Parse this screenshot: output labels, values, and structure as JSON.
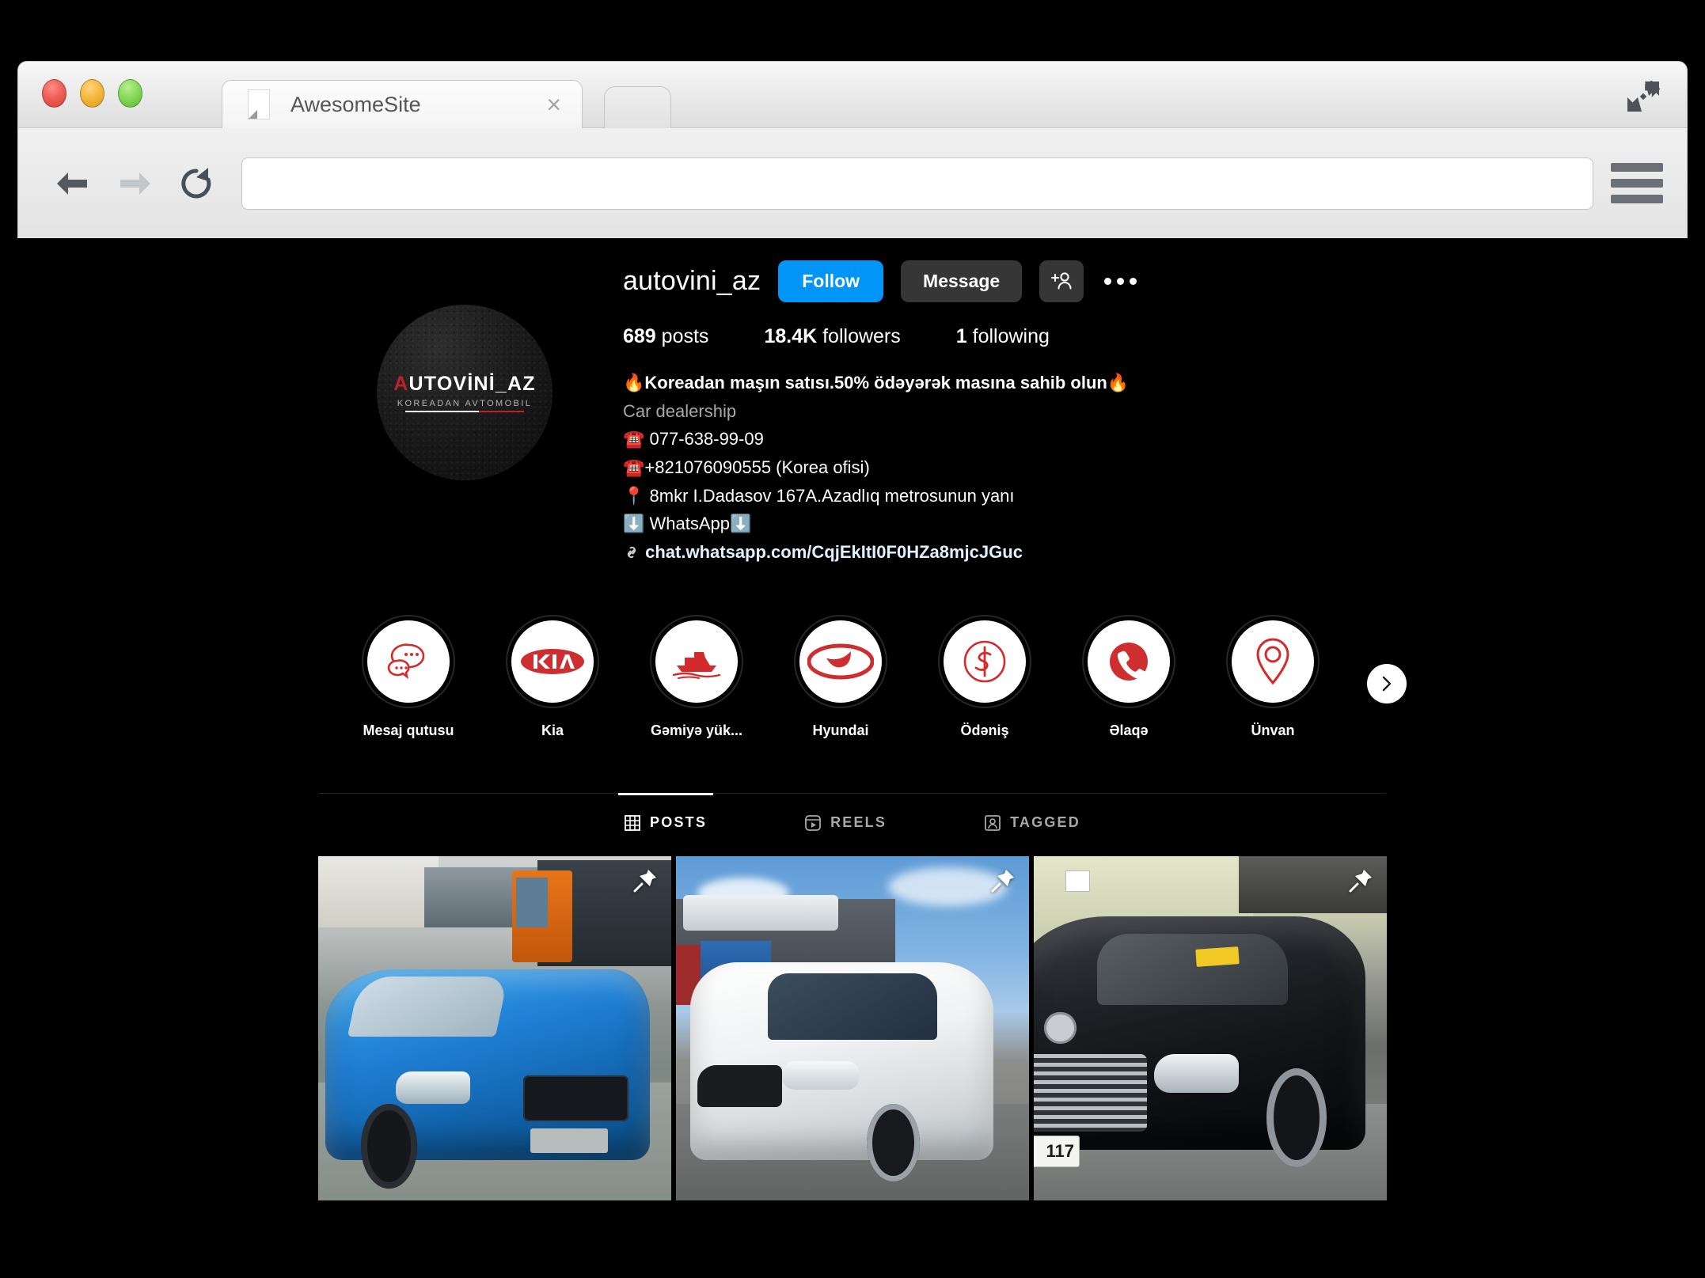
{
  "browser": {
    "tab_title": "AwesomeSite",
    "url_value": "",
    "url_placeholder": "",
    "back_label": "Back",
    "forward_label": "Forward",
    "reload_label": "Reload",
    "menu_label": "Menu",
    "expand_label": "Full screen",
    "close_tab_label": "×"
  },
  "profile": {
    "username": "autovini_az",
    "avatar": {
      "logo_a": "A",
      "logo_rest": "UTOVİNİ_AZ",
      "subtitle": "KOREADAN AVTOMOBIL"
    },
    "buttons": {
      "follow": "Follow",
      "message": "Message",
      "add_user": "add-user",
      "more": "more-options"
    },
    "stats": {
      "posts_count": "689",
      "posts_label": "posts",
      "followers_count": "18.4K",
      "followers_label": "followers",
      "following_count": "1",
      "following_label": "following"
    },
    "bio": {
      "title": "🔥Koreadan maşın satısı.50% ödəyərək masına sahib olun🔥",
      "category": "Car dealership",
      "phone1": "☎️ 077-638-99-09",
      "phone2": "☎️+821076090555 (Korea ofisi)",
      "address": "📍 8mkr I.Dadasov 167A.Azadlıq metrosunun yanı",
      "whatsapp": "⬇️ WhatsApp⬇️",
      "link": "chat.whatsapp.com/CqjEkItI0F0HZa8mjcJGuc"
    }
  },
  "highlights": {
    "next_label": "next",
    "items": [
      {
        "label": "Mesaj qutusu",
        "icon": "chat-bubbles-icon"
      },
      {
        "label": "Kia",
        "icon": "kia-logo-icon"
      },
      {
        "label": "Gəmiyə yük...",
        "icon": "ship-icon"
      },
      {
        "label": "Hyundai",
        "icon": "hyundai-logo-icon"
      },
      {
        "label": "Ödəniş",
        "icon": "dollar-icon"
      },
      {
        "label": "Əlaqə",
        "icon": "phone-icon"
      },
      {
        "label": "Ünvan",
        "icon": "map-pin-icon"
      }
    ]
  },
  "tabs": [
    {
      "label": "POSTS",
      "icon": "grid-icon",
      "active": true
    },
    {
      "label": "REELS",
      "icon": "reels-icon",
      "active": false
    },
    {
      "label": "TAGGED",
      "icon": "tagged-icon",
      "active": false
    }
  ],
  "grid": [
    {
      "alt": "Blue BMW coupe in industrial yard",
      "pinned": true
    },
    {
      "alt": "White Kia Sorento SUV beside car carrier truck",
      "pinned": true
    },
    {
      "alt": "Black Mercedes-Benz S-Class sedan",
      "pinned": true,
      "plate": "117"
    }
  ],
  "colors": {
    "accent_blue": "#0095F6",
    "button_gray": "#363636",
    "highlight_red": "#CE2B37",
    "page_bg": "#000000"
  }
}
